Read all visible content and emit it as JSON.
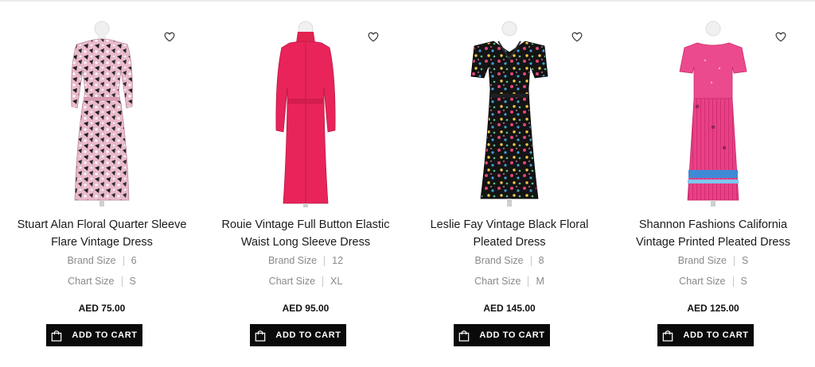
{
  "products": [
    {
      "title_line1": "Stuart Alan Floral Quarter Sleeve",
      "title_line2": "Flare Vintage Dress",
      "brand_size_label": "Brand Size",
      "brand_size": "6",
      "chart_size_label": "Chart Size",
      "chart_size": "S",
      "price": "AED 75.00",
      "cart_label": "ADD TO CART",
      "icons": {
        "wishlist": "heart-icon",
        "cart": "shopping-bag-icon"
      }
    },
    {
      "title_line1": "Rouie Vintage Full Button Elastic",
      "title_line2": "Waist Long Sleeve Dress",
      "brand_size_label": "Brand Size",
      "brand_size": "12",
      "chart_size_label": "Chart Size",
      "chart_size": "XL",
      "price": "AED 95.00",
      "cart_label": "ADD TO CART",
      "icons": {
        "wishlist": "heart-icon",
        "cart": "shopping-bag-icon"
      }
    },
    {
      "title_line1": "Leslie Fay Vintage Black Floral",
      "title_line2": "Pleated Dress",
      "brand_size_label": "Brand Size",
      "brand_size": "8",
      "chart_size_label": "Chart Size",
      "chart_size": "M",
      "price": "AED 145.00",
      "cart_label": "ADD TO CART",
      "icons": {
        "wishlist": "heart-icon",
        "cart": "shopping-bag-icon"
      }
    },
    {
      "title_line1": "Shannon Fashions California",
      "title_line2": "Vintage Printed Pleated Dress",
      "brand_size_label": "Brand Size",
      "brand_size": "S",
      "chart_size_label": "Chart Size",
      "chart_size": "S",
      "price": "AED 125.00",
      "cart_label": "ADD TO CART",
      "icons": {
        "wishlist": "heart-icon",
        "cart": "shopping-bag-icon"
      }
    }
  ],
  "colors": {
    "button_bg": "#0a0a0a",
    "button_text": "#ffffff",
    "muted_text": "#8a8a8a",
    "dress_floral_pink": "#e7b6c8",
    "dress_red": "#e8245a",
    "dress_black_floral": "#141414",
    "dress_pink": "#ea3f86"
  }
}
